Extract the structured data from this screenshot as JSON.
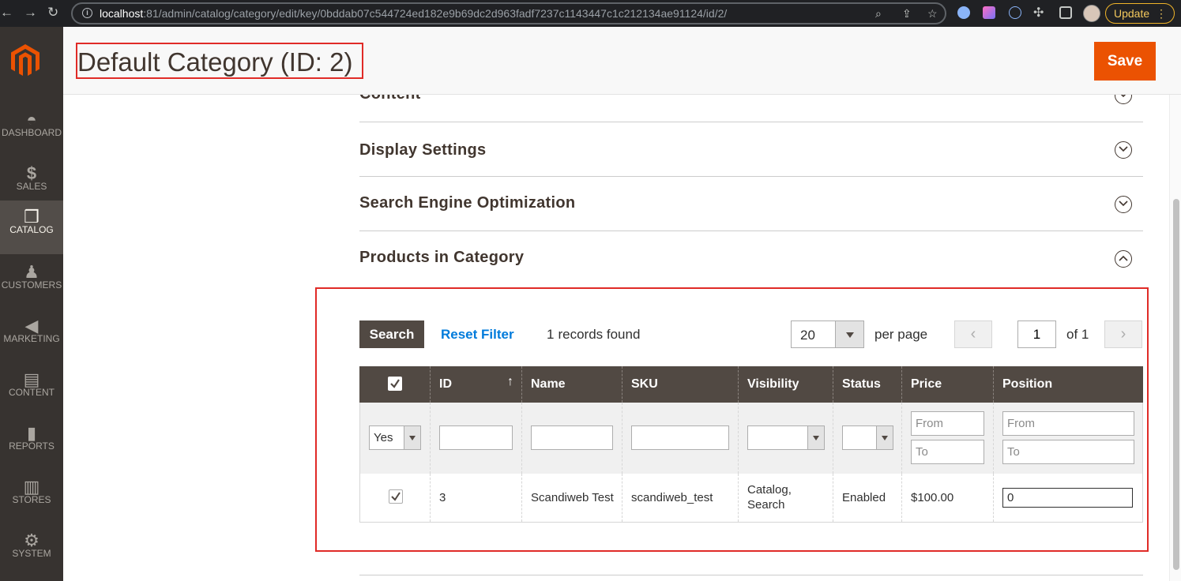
{
  "browser": {
    "url_host": "localhost",
    "url_path": ":81/admin/catalog/category/edit/key/0bddab07c544724ed182e9b69dc2d963fadf7237c1143447c1c212134ae91124/id/2/",
    "update_label": "Update"
  },
  "sidebar": {
    "items": [
      {
        "label": "DASHBOARD",
        "icon": "dashboard-icon"
      },
      {
        "label": "SALES",
        "icon": "dollar-icon"
      },
      {
        "label": "CATALOG",
        "icon": "box-icon",
        "active": true
      },
      {
        "label": "CUSTOMERS",
        "icon": "person-icon"
      },
      {
        "label": "MARKETING",
        "icon": "megaphone-icon"
      },
      {
        "label": "CONTENT",
        "icon": "layout-icon"
      },
      {
        "label": "REPORTS",
        "icon": "bar-chart-icon"
      },
      {
        "label": "STORES",
        "icon": "store-icon"
      },
      {
        "label": "SYSTEM",
        "icon": "gear-icon"
      }
    ]
  },
  "header": {
    "title": "Default Category (ID: 2)",
    "save_label": "Save"
  },
  "sections": [
    {
      "title": "Content",
      "state": "collapsed"
    },
    {
      "title": "Display Settings",
      "state": "collapsed"
    },
    {
      "title": "Search Engine Optimization",
      "state": "collapsed"
    },
    {
      "title": "Products in Category",
      "state": "expanded"
    }
  ],
  "grid": {
    "search_label": "Search",
    "reset_label": "Reset Filter",
    "records_count": "1",
    "records_text": "records found",
    "per_page_value": "20",
    "per_page_label": "per page",
    "page_value": "1",
    "page_of": "of 1",
    "columns": [
      "ID",
      "Name",
      "SKU",
      "Visibility",
      "Status",
      "Price",
      "Position"
    ],
    "filters": {
      "in_category": "Yes",
      "price_from_placeholder": "From",
      "price_to_placeholder": "To",
      "position_from_placeholder": "From",
      "position_to_placeholder": "To"
    },
    "rows": [
      {
        "checked": true,
        "id": "3",
        "name": "Scandiweb Test",
        "sku": "scandiweb_test",
        "visibility_line1": "Catalog,",
        "visibility_line2": "Search",
        "status": "Enabled",
        "price": "$100.00",
        "position": "0"
      }
    ]
  },
  "colors": {
    "accent": "#eb5202",
    "sidebar_bg": "#373330",
    "grid_header": "#514943",
    "highlight_frame": "#e02b27",
    "link": "#007bdb"
  }
}
